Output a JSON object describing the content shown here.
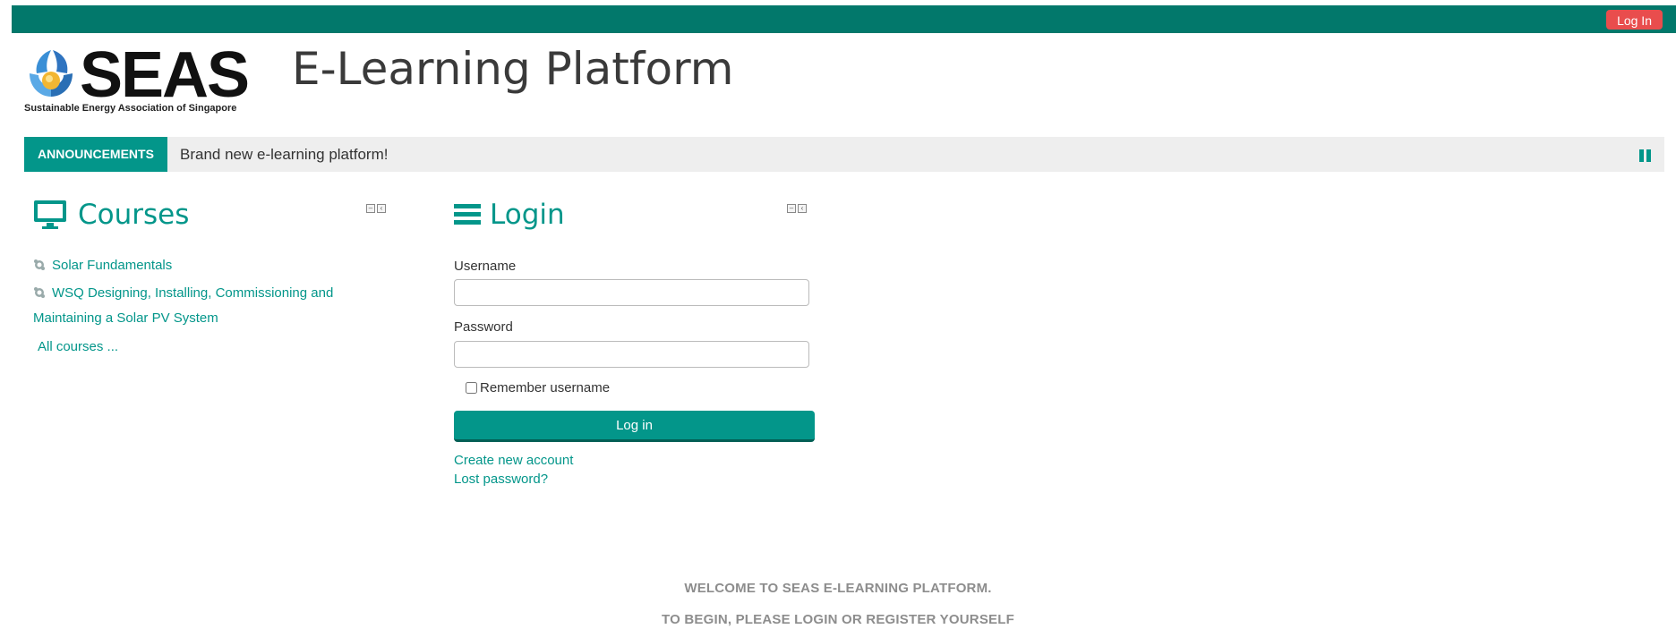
{
  "topbar": {
    "login_label": "Log In",
    "color": "#02786b",
    "login_color": "#e94d4d"
  },
  "logo": {
    "word": "SEAS",
    "tagline": "Sustainable Energy Association of Singapore"
  },
  "site_title": "E-Learning Platform",
  "announcements": {
    "label": "ANNOUNCEMENTS",
    "text": "Brand new e-learning platform!",
    "pause_icon": "pause-icon"
  },
  "courses_block": {
    "title": "Courses",
    "icon": "monitor-icon",
    "items": [
      {
        "label_line1": "Solar Fundamentals",
        "label_line2": ""
      },
      {
        "label_line1": "WSQ Designing, Installing, Commissioning and",
        "label_line2": "Maintaining a Solar PV System"
      }
    ],
    "all_courses": "All courses ..."
  },
  "login_block": {
    "title": "Login",
    "icon": "hamburger-icon",
    "username_label": "Username",
    "username_value": "",
    "password_label": "Password",
    "password_value": "",
    "remember_label": "Remember username",
    "button_label": "Log in",
    "create_account": "Create new account",
    "lost_password": "Lost password?"
  },
  "welcome": {
    "line1": "WELCOME TO SEAS E-LEARNING PLATFORM.",
    "line2": "TO BEGIN, PLEASE LOGIN OR REGISTER YOURSELF"
  },
  "colors": {
    "accent": "#03968a",
    "announce_bg": "#eeeeee"
  }
}
